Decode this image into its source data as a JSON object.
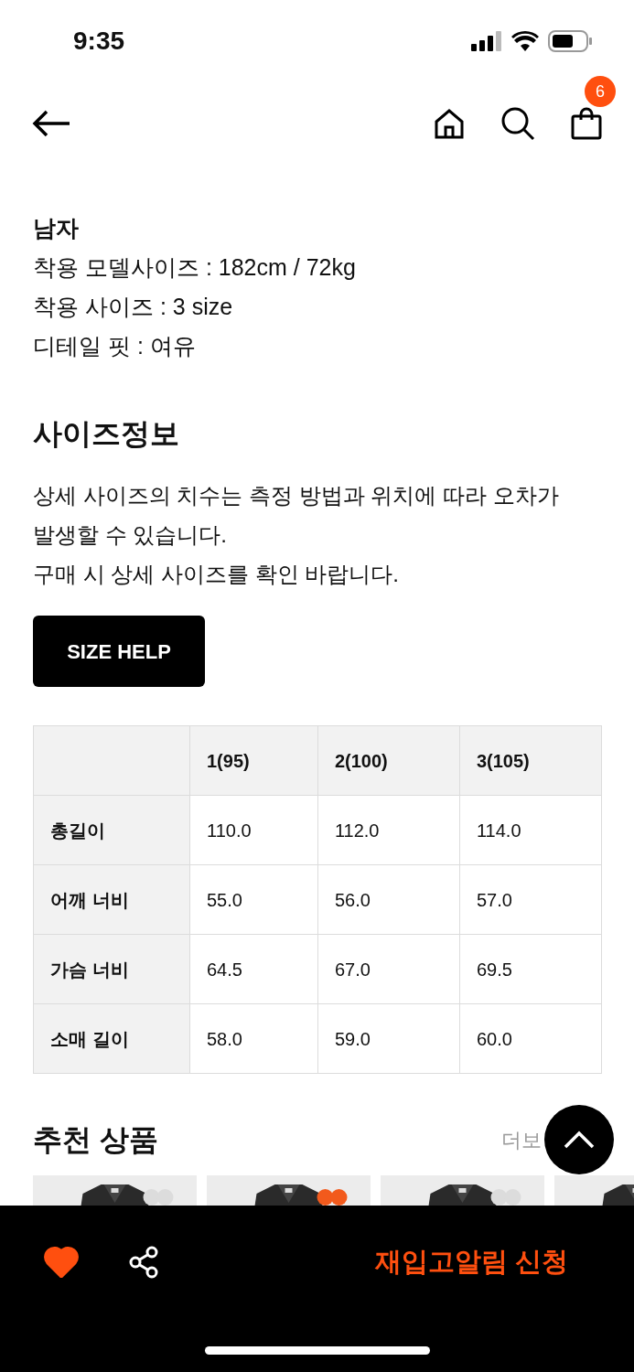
{
  "status_bar": {
    "time": "9:35"
  },
  "header": {
    "cart_count": "6"
  },
  "model_info": {
    "title": "남자",
    "lines": [
      "착용 모델사이즈 : 182cm / 72kg",
      "착용 사이즈 : 3 size",
      "디테일 핏 : 여유"
    ]
  },
  "size_info": {
    "title": "사이즈정보",
    "description": [
      "상세 사이즈의 치수는 측정 방법과 위치에 따라 오차가",
      "발생할 수 있습니다.",
      "구매 시 상세 사이즈를 확인 바랍니다."
    ],
    "help_button": "SIZE HELP"
  },
  "size_table": {
    "columns": [
      "1(95)",
      "2(100)",
      "3(105)"
    ],
    "rows": [
      {
        "label": "총길이",
        "values": [
          "110.0",
          "112.0",
          "114.0"
        ]
      },
      {
        "label": "어깨 너비",
        "values": [
          "55.0",
          "56.0",
          "57.0"
        ]
      },
      {
        "label": "가슴 너비",
        "values": [
          "64.5",
          "67.0",
          "69.5"
        ]
      },
      {
        "label": "소매 길이",
        "values": [
          "58.0",
          "59.0",
          "60.0"
        ]
      }
    ]
  },
  "recommended": {
    "title": "추천 상품",
    "more": "더보"
  },
  "bottom_bar": {
    "liked": true,
    "action": "재입고알림 신청"
  }
}
